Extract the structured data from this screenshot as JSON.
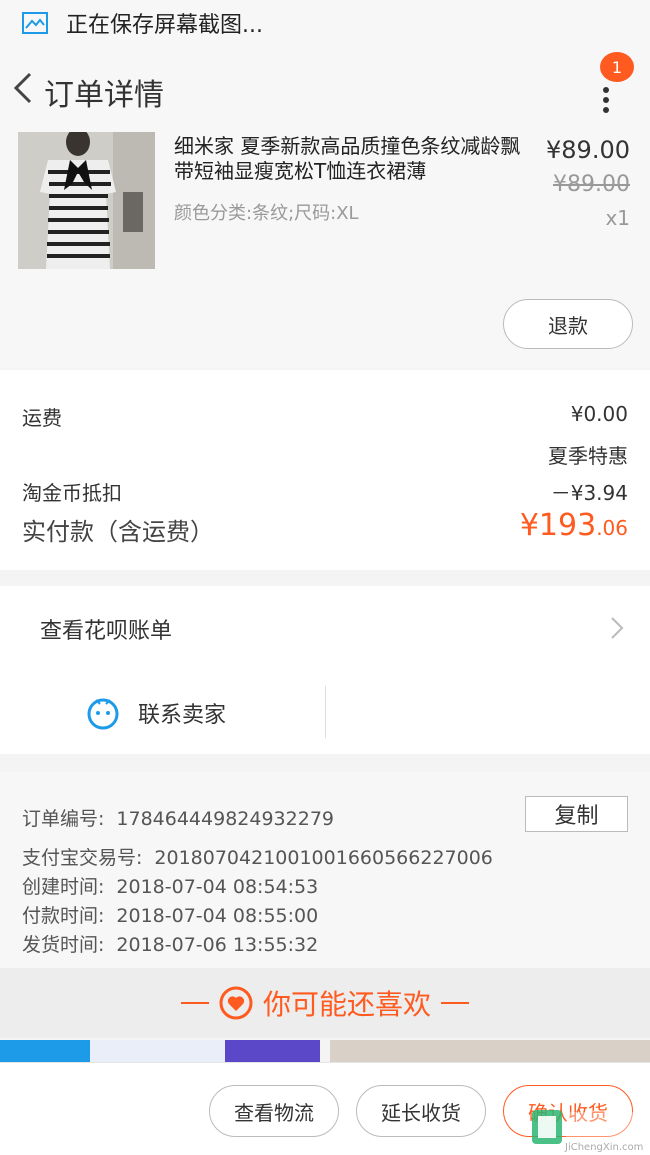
{
  "status_bar": {
    "text": "正在保存屏幕截图..."
  },
  "nav": {
    "title": "订单详情",
    "badge_count": "1"
  },
  "product": {
    "title": "细米家 夏季新款高品质撞色条纹减龄飘带短袖显瘦宽松T恤连衣裙薄",
    "sku": "颜色分类:条纹;尺码:XL",
    "price": "¥89.00",
    "original_price": "¥89.00",
    "quantity": "x1",
    "refund_label": "退款"
  },
  "fees": {
    "shipping_label": "运费",
    "shipping_value": "¥0.00",
    "promo_label": "夏季特惠",
    "coin_label": "淘金币抵扣",
    "coin_value": "－¥3.94",
    "total_label": "实付款（含运费）",
    "total_main": "¥193",
    "total_cents": ".06"
  },
  "huabei": {
    "label": "查看花呗账单",
    "contact_label": "联系卖家"
  },
  "order_info": {
    "order_no_label": "订单编号:",
    "order_no": "178464449824932279",
    "copy_label": "复制",
    "alipay_label": "支付宝交易号:",
    "alipay_no": "2018070421001001660566227006",
    "created_label": "创建时间:",
    "created": "2018-07-04 08:54:53",
    "paid_label": "付款时间:",
    "paid": "2018-07-04 08:55:00",
    "shipped_label": "发货时间:",
    "shipped": "2018-07-06 13:55:32"
  },
  "recommend": {
    "label": "你可能还喜欢"
  },
  "bottom_bar": {
    "logistics_label": "查看物流",
    "extend_label": "延长收货",
    "confirm_label": "确认收货"
  },
  "watermark": {
    "text": "JiChengXin.com"
  },
  "colors": {
    "accent": "#ff5a1f",
    "blue": "#1e9be8"
  }
}
